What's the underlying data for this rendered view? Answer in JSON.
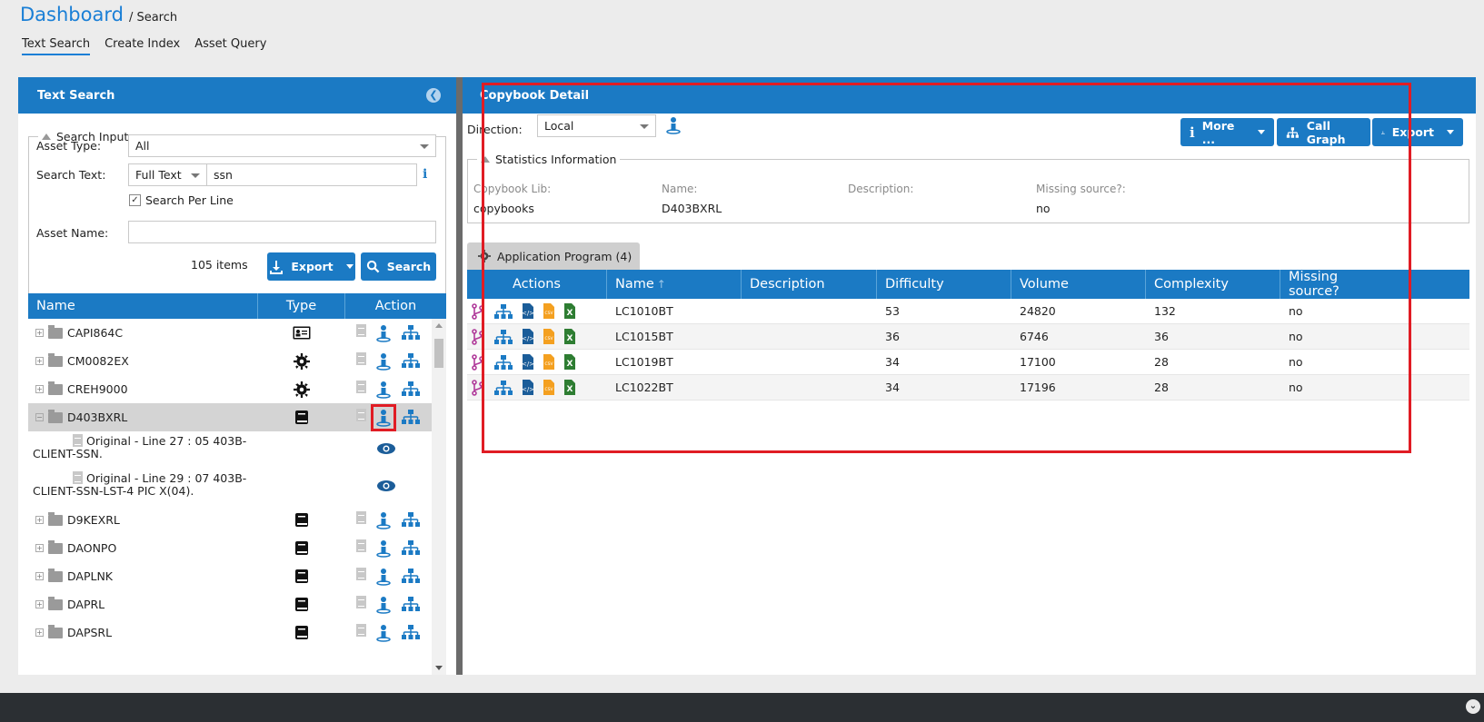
{
  "header": {
    "title": "Dashboard",
    "breadcrumb": "/ Search"
  },
  "tabs": [
    "Text Search",
    "Create Index",
    "Asset Query"
  ],
  "left_panel": {
    "title": "Text Search",
    "search_input": {
      "legend": "Search Input",
      "asset_type_label": "Asset Type:",
      "asset_type_value": "All",
      "search_text_label": "Search Text:",
      "search_mode": "Full Text",
      "search_text_value": "ssn",
      "search_per_line_label": "Search Per Line",
      "search_per_line_checked": true,
      "asset_name_label": "Asset Name:",
      "asset_name_value": "",
      "items_count": "105 items",
      "export_label": "Export",
      "search_label": "Search"
    },
    "grid": {
      "headers": [
        "Name",
        "Type",
        "Action"
      ],
      "rows": [
        {
          "name": "CAPI864C",
          "type_icon": "id-card-icon"
        },
        {
          "name": "CM0082EX",
          "type_icon": "gear-icon"
        },
        {
          "name": "CREH9000",
          "type_icon": "gear-icon"
        },
        {
          "name": "D403BXRL",
          "type_icon": "book-icon",
          "expanded": true,
          "selected": true
        },
        {
          "name": "D9KEXRL",
          "type_icon": "book-icon"
        },
        {
          "name": "DAONPO",
          "type_icon": "book-icon"
        },
        {
          "name": "DAPLNK",
          "type_icon": "book-icon"
        },
        {
          "name": "DAPRL",
          "type_icon": "book-icon"
        },
        {
          "name": "DAPSRL",
          "type_icon": "book-icon"
        }
      ],
      "children": [
        {
          "text1": "Original - Line 27 : 05 403B-",
          "text2": "CLIENT-SSN."
        },
        {
          "text1": "Original - Line 29 : 07 403B-",
          "text2": "CLIENT-SSN-LST-4 PIC X(04)."
        }
      ]
    }
  },
  "right_panel": {
    "title": "Copybook Detail",
    "direction_label": "Direction:",
    "direction_value": "Local",
    "more_label": "More ...",
    "call_graph_label": "Call Graph",
    "export_label": "Export",
    "stats": {
      "legend": "Statistics Information",
      "keys": [
        "Copybook Lib:",
        "Name:",
        "Description:",
        "Missing source?:"
      ],
      "values": [
        "copybooks",
        "D403BXRL",
        "",
        "no"
      ]
    },
    "app_tab": "Application Program (4)",
    "program_grid": {
      "headers": [
        "Actions",
        "Name",
        "Description",
        "Difficulty",
        "Volume",
        "Complexity",
        "Missing source?"
      ],
      "rows": [
        {
          "name": "LC1010BT",
          "description": "",
          "difficulty": "53",
          "volume": "24820",
          "complexity": "132",
          "missing": "no"
        },
        {
          "name": "LC1015BT",
          "description": "",
          "difficulty": "36",
          "volume": "6746",
          "complexity": "36",
          "missing": "no"
        },
        {
          "name": "LC1019BT",
          "description": "",
          "difficulty": "34",
          "volume": "17100",
          "complexity": "28",
          "missing": "no"
        },
        {
          "name": "LC1022BT",
          "description": "",
          "difficulty": "34",
          "volume": "17196",
          "complexity": "28",
          "missing": "no"
        }
      ]
    }
  },
  "colors": {
    "accent": "#1b7ac4",
    "title_blue": "#1a7fd6",
    "highlight_red": "#e01c24"
  }
}
